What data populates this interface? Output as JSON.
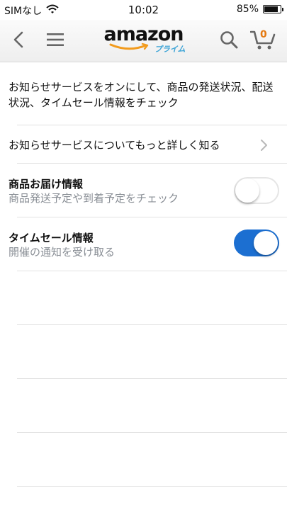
{
  "status_bar": {
    "carrier": "SIMなし",
    "time": "10:02",
    "battery": "85%",
    "battery_level": 0.85
  },
  "header": {
    "logo_text": "amazon",
    "logo_sub": "プライム",
    "cart_count": "0"
  },
  "intro_text": "お知らせサービスをオンにして、商品の発送状況、配送状況、タイムセール情報をチェック",
  "learn_more": {
    "label": "お知らせサービスについてもっと詳しく知る"
  },
  "settings": [
    {
      "title": "商品お届け情報",
      "description": "商品発送予定や到着予定をチェック",
      "enabled": false
    },
    {
      "title": "タイムセール情報",
      "description": "開催の通知を受け取る",
      "enabled": true
    }
  ],
  "colors": {
    "toggle_on": "#1c6fd1",
    "cart_accent": "#e47911",
    "prime_blue": "#3aa3d6",
    "secondary_text": "#8a8f96"
  }
}
